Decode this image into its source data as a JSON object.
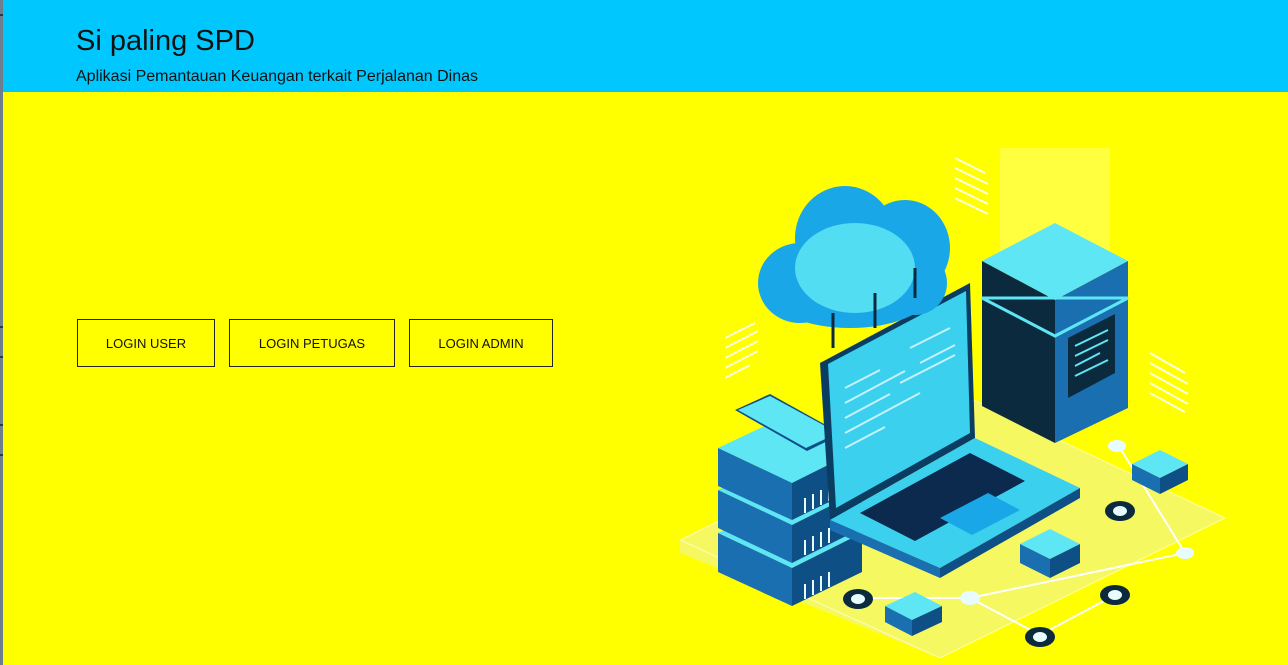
{
  "header": {
    "title": "Si paling SPD",
    "subtitle": "Aplikasi Pemantauan Keuangan terkait Perjalanan Dinas",
    "background_color": "#00c8ff"
  },
  "page": {
    "background_color": "#ffff00"
  },
  "login_buttons": [
    {
      "label": "LOGIN USER"
    },
    {
      "label": "LOGIN PETUGAS"
    },
    {
      "label": "LOGIN ADMIN"
    }
  ],
  "illustration": {
    "icon": "cloud-server-laptop-illustration",
    "accent_colors": [
      "#1aa7e8",
      "#5ee6f5",
      "#0b3d63"
    ]
  }
}
